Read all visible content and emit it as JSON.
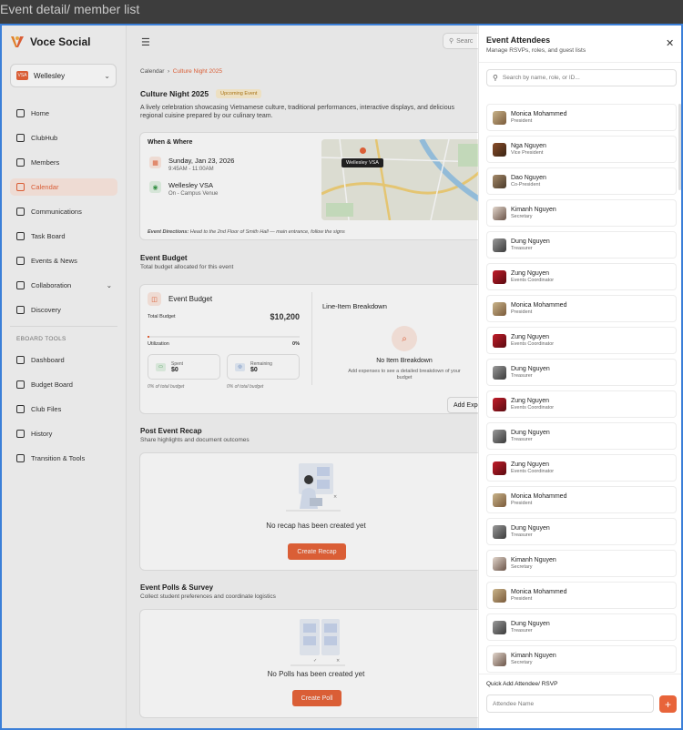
{
  "window": {
    "title": "Event detail/ member list"
  },
  "app": {
    "name": "Voce Social",
    "accent": "#e8643a"
  },
  "club": {
    "badge": "VSA",
    "name": "Wellesley"
  },
  "nav": {
    "items": [
      {
        "label": "Home",
        "icon": "home-icon"
      },
      {
        "label": "ClubHub",
        "icon": "clubhub-icon"
      },
      {
        "label": "Members",
        "icon": "members-icon"
      },
      {
        "label": "Calendar",
        "icon": "calendar-icon",
        "active": true
      },
      {
        "label": "Communications",
        "icon": "chat-icon"
      },
      {
        "label": "Task Board",
        "icon": "clipboard-icon"
      },
      {
        "label": "Events & News",
        "icon": "news-icon"
      },
      {
        "label": "Collaboration",
        "icon": "handshake-icon"
      },
      {
        "label": "Discovery",
        "icon": "search-icon"
      }
    ],
    "section": "EBOARD TOOLS",
    "tools": [
      {
        "label": "Dashboard",
        "icon": "grid-icon"
      },
      {
        "label": "Budget Board",
        "icon": "dollar-icon"
      },
      {
        "label": "Club Files",
        "icon": "folder-icon"
      },
      {
        "label": "History",
        "icon": "clock-icon"
      },
      {
        "label": "Transition & Tools",
        "icon": "document-icon"
      }
    ]
  },
  "header": {
    "search_placeholder": "Searc"
  },
  "breadcrumb": {
    "parent": "Calendar",
    "current": "Culture Night 2025"
  },
  "event": {
    "title": "Culture Night 2025",
    "status": "Upcoming Event",
    "description": "A lively celebration showcasing Vietnamese culture, traditional performances, interactive displays, and delicious regional cuisine prepared by our culinary team."
  },
  "when_where": {
    "title": "When & Where",
    "date": "Sunday, Jan 23, 2026",
    "time": "9:45AM - 11:00AM",
    "venue": "Wellesley VSA",
    "venue_sub": "On - Campus Venue",
    "map_label": "Wellesley VSA",
    "directions_label": "Event Directions:",
    "directions": "Head to the 2nd Floor of Smith Hall — main entrance, follow the signs"
  },
  "budget": {
    "section_title": "Event Budget",
    "section_sub": "Total budget allocated for this event",
    "card_title": "Event Budget",
    "total_label": "Total Budget",
    "total_value": "$10,200",
    "util_label": "Utilization",
    "util_value": "0%",
    "utilization_fraction": 0.0,
    "spent_label": "Spent",
    "spent_value": "$0",
    "remaining_label": "Remaining",
    "remaining_value": "$0",
    "spent_note": "0% of total budget",
    "remaining_note": "0% of total budget",
    "lineitem_title": "Line-Item Breakdown",
    "empty_title": "No Item Breakdown",
    "empty_sub": "Add expenses to see a detailed breakdown of your budget",
    "add_button": "Add Expense"
  },
  "recap": {
    "title": "Post Event Recap",
    "sub": "Share highlights and document outcomes",
    "empty": "No recap has been created yet",
    "button": "Create Recap"
  },
  "polls": {
    "title": "Event Polls & Survey",
    "sub": "Collect student preferences and coordinate logistics",
    "empty": "No Polls has been created yet",
    "button": "Create Poll"
  },
  "drawer": {
    "title": "Event Attendees",
    "subtitle": "Manage RSVPs, roles, and guest lists",
    "search_placeholder": "Search by name, role, or ID...",
    "attendees": [
      {
        "name": "Monica Mohammed",
        "role": "President",
        "avatar": "a1"
      },
      {
        "name": "Nga Nguyen",
        "role": "Vice President",
        "avatar": "a2"
      },
      {
        "name": "Dao Nguyen",
        "role": "Co-President",
        "avatar": "a3"
      },
      {
        "name": "Kimanh Nguyen",
        "role": "Secretary",
        "avatar": "a4"
      },
      {
        "name": "Dung Nguyen",
        "role": "Treasurer",
        "avatar": "a5"
      },
      {
        "name": "Zung Nguyen",
        "role": "Events Coordinator",
        "avatar": "a6"
      },
      {
        "name": "Monica Mohammed",
        "role": "President",
        "avatar": "a1"
      },
      {
        "name": "Zung Nguyen",
        "role": "Events Coordinator",
        "avatar": "a6"
      },
      {
        "name": "Dung Nguyen",
        "role": "Treasurer",
        "avatar": "a5"
      },
      {
        "name": "Zung Nguyen",
        "role": "Events Coordinator",
        "avatar": "a6"
      },
      {
        "name": "Dung Nguyen",
        "role": "Treasurer",
        "avatar": "a5"
      },
      {
        "name": "Zung Nguyen",
        "role": "Events Coordinator",
        "avatar": "a6"
      },
      {
        "name": "Monica Mohammed",
        "role": "President",
        "avatar": "a1"
      },
      {
        "name": "Dung Nguyen",
        "role": "Treasurer",
        "avatar": "a5"
      },
      {
        "name": "Kimanh Nguyen",
        "role": "Secretary",
        "avatar": "a4"
      },
      {
        "name": "Monica Mohammed",
        "role": "President",
        "avatar": "a1"
      },
      {
        "name": "Dung Nguyen",
        "role": "Treasurer",
        "avatar": "a5"
      },
      {
        "name": "Kimanh Nguyen",
        "role": "Secretary",
        "avatar": "a4"
      }
    ],
    "quick_add_title": "Quick Add Attendee/ RSVP",
    "quick_add_placeholder": "Attendee Name",
    "quick_add_button": "+"
  }
}
